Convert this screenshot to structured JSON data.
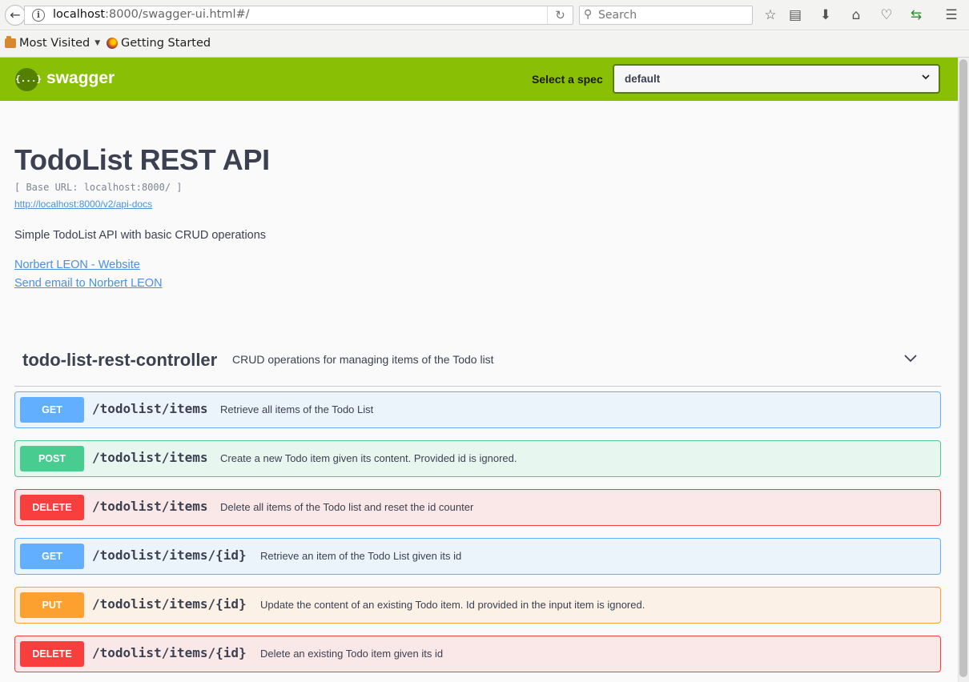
{
  "browser": {
    "url_host": "localhost",
    "url_rest": ":8000/swagger-ui.html#/",
    "search_placeholder": "Search",
    "bookmarks": [
      {
        "label": "Most Visited"
      },
      {
        "label": "Getting Started"
      }
    ]
  },
  "swagger": {
    "logo_text": "swagger",
    "logo_glyph": "{...}",
    "spec_label": "Select a spec",
    "spec_value": "default"
  },
  "info": {
    "title": "TodoList REST API",
    "base_url": "[ Base URL: localhost:8000/ ]",
    "api_docs_link": "http://localhost:8000/v2/api-docs",
    "description": "Simple TodoList API with basic CRUD operations",
    "contact_website": "Norbert LEON - Website",
    "contact_email": "Send email to Norbert LEON"
  },
  "tag": {
    "name": "todo-list-rest-controller",
    "description": "CRUD operations for managing items of the Todo list"
  },
  "operations": [
    {
      "method": "GET",
      "path": "/todolist/items",
      "summary": "Retrieve all items of the Todo List"
    },
    {
      "method": "POST",
      "path": "/todolist/items",
      "summary": "Create a new Todo item given its content. Provided id is ignored."
    },
    {
      "method": "DELETE",
      "path": "/todolist/items",
      "summary": "Delete all items of the Todo list and reset the id counter"
    },
    {
      "method": "GET",
      "path": "/todolist/items/{id}",
      "summary": "Retrieve an item of the Todo List given its id"
    },
    {
      "method": "PUT",
      "path": "/todolist/items/{id}",
      "summary": "Update the content of an existing Todo item. Id provided in the input item is ignored."
    },
    {
      "method": "DELETE",
      "path": "/todolist/items/{id}",
      "summary": "Delete an existing Todo item given its id"
    }
  ],
  "colors": {
    "topbar": "#89bf04",
    "get": "#61affe",
    "post": "#49cc90",
    "delete": "#f93e3e",
    "put": "#fca130",
    "link": "#4990e2"
  }
}
